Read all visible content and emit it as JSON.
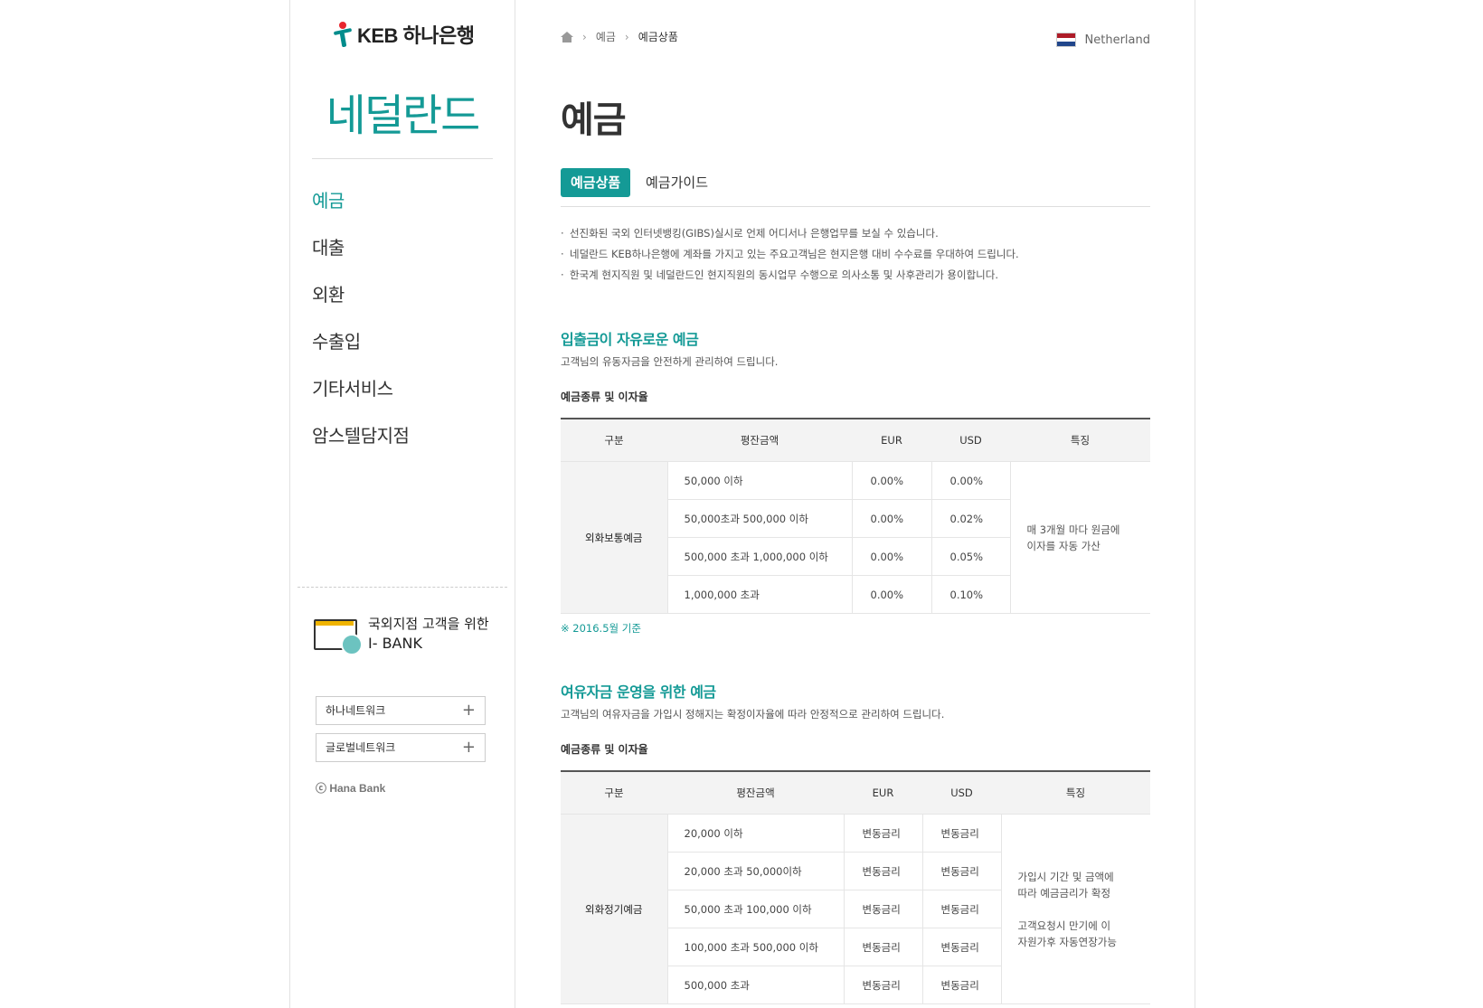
{
  "brand": {
    "logo_text": "KEB 하나은행",
    "country": "네덜란드",
    "copyright": "ⓒ Hana Bank"
  },
  "sidebar": {
    "items": [
      {
        "label": "예금",
        "active": true
      },
      {
        "label": "대출"
      },
      {
        "label": "외환"
      },
      {
        "label": "수출입"
      },
      {
        "label": "기타서비스"
      },
      {
        "label": "암스텔담지점"
      }
    ],
    "ibank": {
      "line1": "국외지점 고객을 위한",
      "line2": "I- BANK"
    },
    "networks": [
      "하나네트워크",
      "글로벌네트워크"
    ],
    "plus": "+"
  },
  "breadcrumb": [
    "예금",
    "예금상품"
  ],
  "country_selector": {
    "label": "Netherland",
    "flag_colors": [
      "#ae1c28",
      "#ffffff",
      "#21468b"
    ]
  },
  "page_title": "예금",
  "tabs": [
    {
      "label": "예금상품",
      "active": true
    },
    {
      "label": "예금가이드"
    }
  ],
  "bullets": [
    "선진화된 국외 인터넷뱅킹(GIBS)실시로 언제 어디서나 은행업무를 보실 수 있습니다.",
    "네덜란드 KEB하나은행에 계좌를 가지고 있는 주요고객님은 현지은행 대비 수수료를 우대하여 드립니다.",
    "한국계 현지직원 및 네덜란드인 현지직원의 동시업무 수행으로 의사소통 및 사후관리가 용이합니다."
  ],
  "sections": [
    {
      "title": "입출금이 자유로운 예금",
      "desc": "고객님의 유동자금을 안전하게 관리하여 드립니다.",
      "sub_title": "예금종류 및 이자율",
      "table": {
        "headers": [
          "구분",
          "평잔금액",
          "EUR",
          "USD",
          "특징"
        ],
        "category": "외화보통예금",
        "rows": [
          [
            "50,000 이하",
            "0.00%",
            "0.00%"
          ],
          [
            "50,000초과 500,000 이하",
            "0.00%",
            "0.02%"
          ],
          [
            "500,000 초과 1,000,000 이하",
            "0.00%",
            "0.05%"
          ],
          [
            "1,000,000 초과",
            "0.00%",
            "0.10%"
          ]
        ],
        "feature": [
          "매 3개월 마다 원금에",
          "이자를 자동 가산"
        ]
      },
      "note": "※ 2016.5월 기준"
    },
    {
      "title": "여유자금 운영을 위한 예금",
      "desc": "고객님의 여유자금을 가입시 정해지는 확정이자율에 따라 안정적으로 관리하여 드립니다.",
      "sub_title": "예금종류 및 이자율",
      "table": {
        "headers": [
          "구분",
          "평잔금액",
          "EUR",
          "USD",
          "특징"
        ],
        "category": "외화정기예금",
        "rows": [
          [
            "20,000 이하",
            "변동금리",
            "변동금리"
          ],
          [
            "20,000 초과 50,000이하",
            "변동금리",
            "변동금리"
          ],
          [
            "50,000 초과 100,000 이하",
            "변동금리",
            "변동금리"
          ],
          [
            "100,000 초과 500,000 이하",
            "변동금리",
            "변동금리"
          ],
          [
            "500,000 초과",
            "변동금리",
            "변동금리"
          ]
        ],
        "feature": [
          "가입시 기간 및 금액에",
          "따라 예금금리가 확정",
          "",
          "고객요청시 만기에 이",
          "자원가후 자동연장가능"
        ]
      }
    }
  ]
}
